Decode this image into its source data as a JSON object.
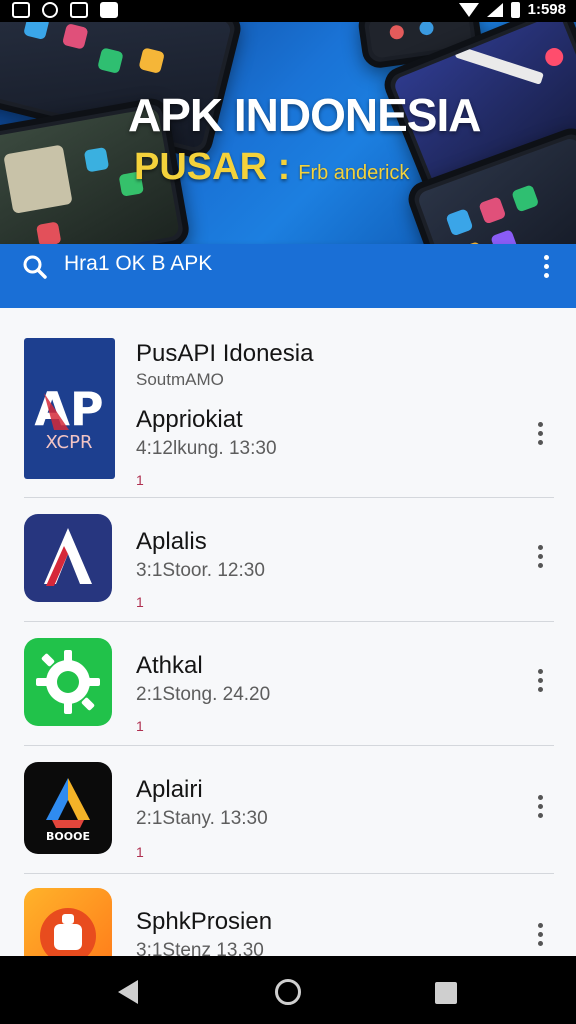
{
  "status_bar": {
    "time": "1:598",
    "icons": [
      "notification-icon",
      "clock-icon",
      "gallery-icon",
      "bag-icon",
      "wifi-icon",
      "signal-icon",
      "battery-icon"
    ]
  },
  "banner": {
    "title": "APK INDONESIA",
    "subtitle_big": "PUSAR :",
    "subtitle_small": "Frb anderick"
  },
  "search": {
    "text": "Hra1 OK B APK"
  },
  "apps": [
    {
      "name": "PusAPI Idonesia",
      "publisher": "SoutmAMO",
      "title": "Appriokiat",
      "meta": "4:12lkung. 13:30",
      "num": "1",
      "icon": "apk-logo-icon"
    },
    {
      "name": "Aplalis",
      "meta": "3:1Stoor. 12:30",
      "num": "1",
      "icon": "a-logo-icon"
    },
    {
      "name": "Athkal",
      "meta": "2:1Stong. 24.20",
      "num": "1",
      "icon": "gear-icon"
    },
    {
      "name": "Aplairi",
      "meta": "2:1Stany. 13:30",
      "num": "1",
      "icon": "triangle-logo-icon",
      "icon_text": "BOOOE"
    },
    {
      "name": "SphkProsien",
      "meta": "3:1Stenz 13.30",
      "icon": "android-icon"
    }
  ],
  "colors": {
    "toolbar": "#1a6fd6",
    "banner_gold": "#f4d23b",
    "navbar": "#000000"
  }
}
